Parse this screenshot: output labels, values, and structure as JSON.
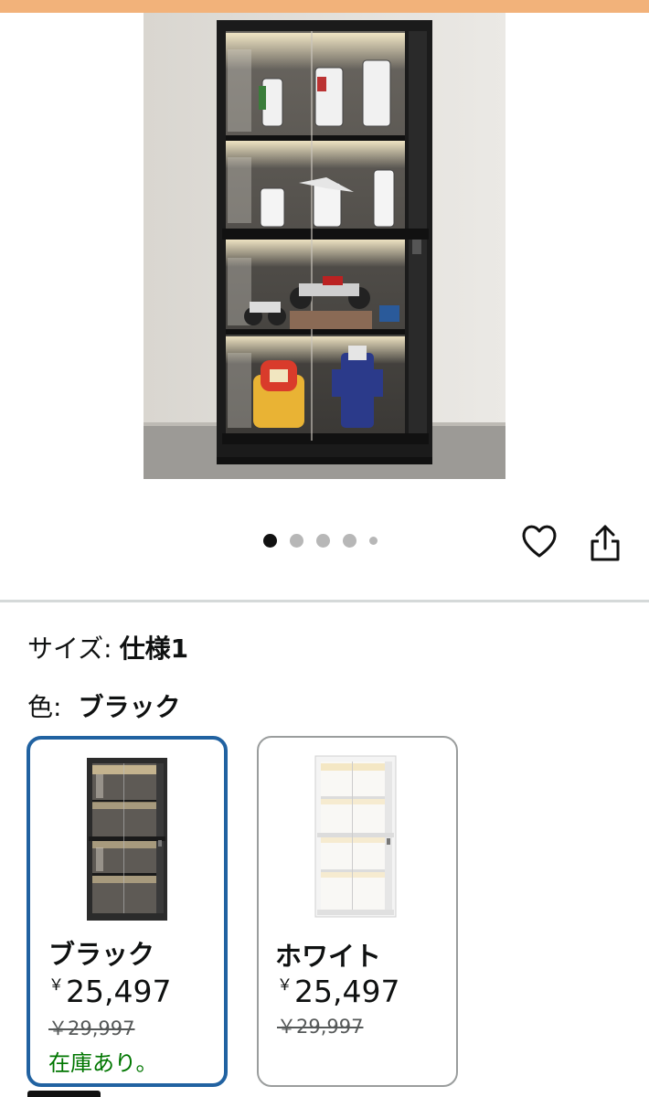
{
  "gallery": {
    "image_count": 5,
    "active_index": 0
  },
  "actions": {
    "wishlist_icon": "heart-icon",
    "share_icon": "share-icon"
  },
  "variations": {
    "size": {
      "label": "サイズ:",
      "value": "仕様1"
    },
    "color": {
      "label": "色:",
      "value": "ブラック"
    }
  },
  "swatches": [
    {
      "name": "ブラック",
      "currency": "￥",
      "price": "25,497",
      "list_price": "￥29,997",
      "availability": "在庫あり。",
      "selected": true,
      "frame_color": "#2b2b2b"
    },
    {
      "name": "ホワイト",
      "currency": "￥",
      "price": "25,497",
      "list_price": "￥29,997",
      "availability": "",
      "selected": false,
      "frame_color": "#f2f2f2"
    }
  ],
  "colors": {
    "selected_border": "#2162a1",
    "in_stock": "#007600",
    "top_banner": "#f2b27a"
  }
}
